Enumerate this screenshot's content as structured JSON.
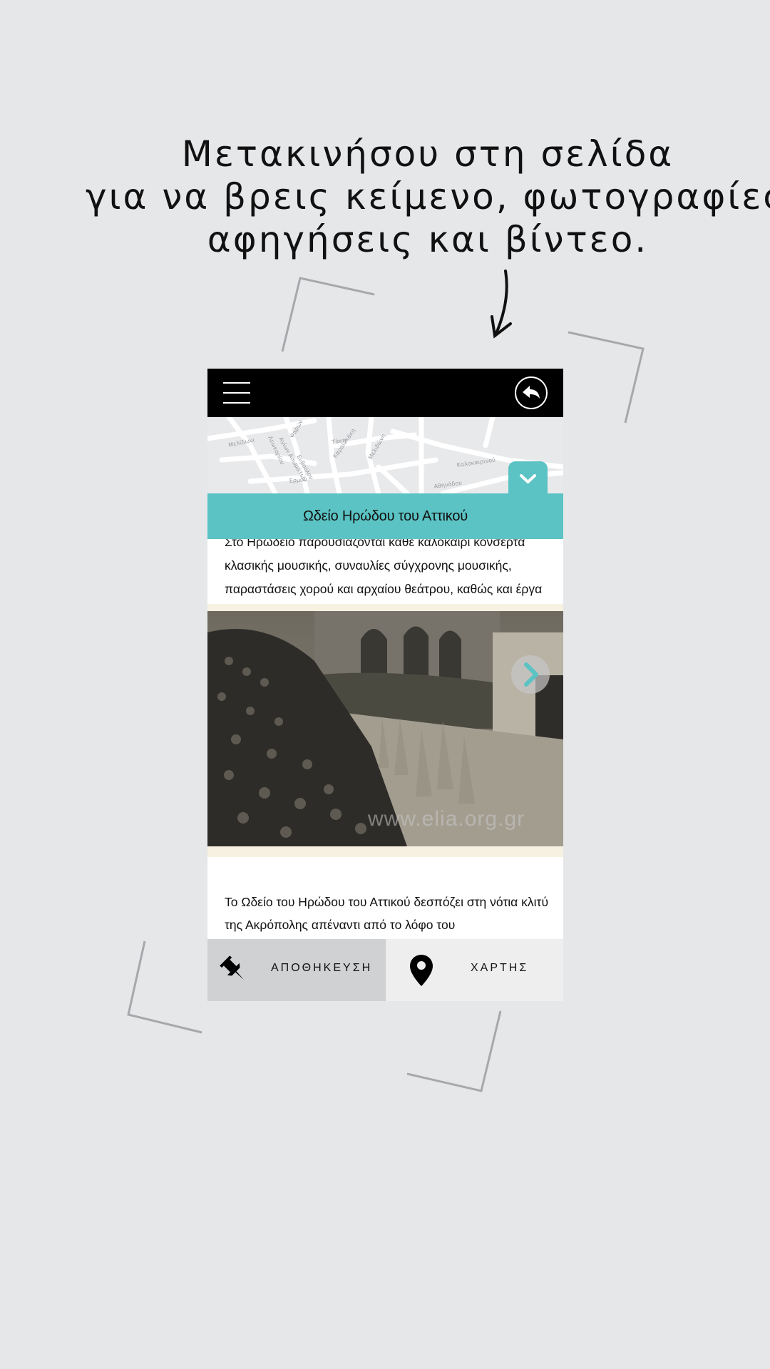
{
  "instruction": {
    "line1": "Μετακινήσου στη σελίδα",
    "line2": "για να βρεις κείμενο, φωτογραφίες,",
    "line3": "αφηγήσεις και βίντεο."
  },
  "app": {
    "topbar": {
      "menu_icon": "hamburger-menu-icon",
      "back_icon": "back-arrow-icon"
    },
    "map_labels": [
      "Μελίδωνι",
      "Λεωκορίου",
      "Αγίων Ασωμάτων",
      "Ψαρών",
      "Ευβούλου",
      "Τάκη",
      "Ερμού",
      "Καραϊσκάκη",
      "Μελιδώνη",
      "Καλοκαιρινού",
      "Αθηνάδου"
    ],
    "collapse_icon": "chevron-down-icon",
    "title": "Ωδείο Ηρώδου του Αττικού",
    "text_top": "Στο Ηρώδειο παρουσιάζονται κάθε καλοκαίρι κονσέρτα κλασικής μουσικής, συναυλίες σύγχρονης μουσικής, παραστάσεις χορού και αρχαίου θεάτρου, καθώς και έργα λυρικού ρεπερτορίου.",
    "photo": {
      "watermark": "www.elia.org.gr",
      "next_icon": "chevron-right-icon"
    },
    "text_bottom": "Το Ωδείο του Ηρώδου του Αττικού δεσπόζει στη νότια κλιτύ της Ακρόπολης απέναντι από το λόφο του",
    "bottom_bar": {
      "save_label": "ΑΠΟΘΗΚΕΥΣΗ",
      "save_icon": "pushpin-icon",
      "map_label": "ΧΑΡΤΗΣ",
      "map_icon": "map-pin-icon"
    }
  },
  "colors": {
    "background": "#e6e7e9",
    "accent": "#5bc3c4",
    "topbar": "#000000",
    "save_bg": "#d0d1d3",
    "map_bg": "#eeeeef"
  }
}
